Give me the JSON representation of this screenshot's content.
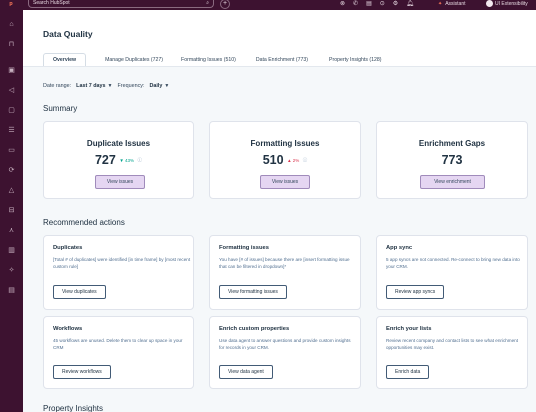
{
  "topbar": {
    "search_placeholder": "Search HubSpot",
    "assistant_label": "Assistant",
    "account_label": "UI Extensibility"
  },
  "header": {
    "title": "Data Quality",
    "tabs": [
      {
        "label": "Overview",
        "active": true
      },
      {
        "label": "Manage Duplicates (727)"
      },
      {
        "label": "Formatting Issues (510)"
      },
      {
        "label": "Data Enrichment (773)"
      },
      {
        "label": "Property Insights (128)"
      }
    ]
  },
  "filters": {
    "date_range_label": "Date range:",
    "date_range_value": "Last 7 days",
    "frequency_label": "Frequency:",
    "frequency_value": "Daily"
  },
  "summary": {
    "title": "Summary",
    "cards": [
      {
        "title": "Duplicate Issues",
        "value": "727",
        "trend": "▼ 43%",
        "trend_dir": "down",
        "button": "View issues"
      },
      {
        "title": "Formatting Issues",
        "value": "510",
        "trend": "▲ 2%",
        "trend_dir": "up",
        "button": "View issues"
      },
      {
        "title": "Enrichment Gaps",
        "value": "773",
        "button": "View enrichment"
      }
    ]
  },
  "recommended": {
    "title": "Recommended actions",
    "cards": [
      {
        "title": "Duplicates",
        "desc": "[Total # of duplicates] were identified [in time frame] by [most recent custom rule]",
        "button": "View duplicates"
      },
      {
        "title": "Formatting issues",
        "desc": "You have [# of issues] because there are [insert formatting issue that can be filtered in dropdown]*",
        "button": "View formatting issues"
      },
      {
        "title": "App sync",
        "desc": "5 app syncs are not connected. Re-connect to bring new data into your CRM.",
        "button": "Review app syncs"
      },
      {
        "title": "Workflows",
        "desc": "45 workflows are unused. Delete them to clear up space in your CRM",
        "button": "Review workflows"
      },
      {
        "title": "Enrich custom properties",
        "desc": "Use data agent to answer questions and provide custom insights for records in your CRM.",
        "button": "View data agent"
      },
      {
        "title": "Enrich your lists",
        "desc": "Review recent company and contact lists to see what enrichment opportunities may exist.",
        "button": "Enrich data"
      }
    ]
  },
  "property_insights": {
    "title": "Property Insights"
  },
  "icons": {
    "sidebar": [
      "home-icon",
      "bookmark-icon",
      "contacts-icon",
      "megaphone-icon",
      "content-icon",
      "inbox-icon",
      "sales-icon",
      "commerce-icon",
      "service-icon",
      "automation-icon",
      "reporting-icon",
      "data-icon",
      "settings-icon",
      "library-icon"
    ],
    "topbar": [
      "search-icon",
      "plus-icon",
      "phone-icon",
      "marketplace-icon",
      "help-icon",
      "settings-icon",
      "notifications-icon",
      "sparkle-icon"
    ]
  },
  "colors": {
    "nav_bg": "#3d1230",
    "primary_button_bg": "#e5d6f2",
    "accent": "#ff7a59",
    "trend_down": "#00a38d",
    "trend_up": "#d9364f"
  }
}
